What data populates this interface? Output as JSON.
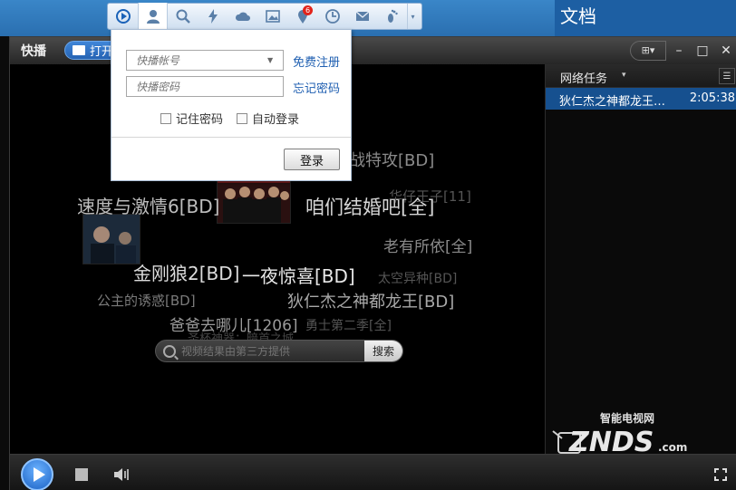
{
  "desktop": {
    "doc_label": "文档"
  },
  "window": {
    "app_title": "快播",
    "open_label": "打开",
    "skin_label": "⊞▾",
    "min_glyph": "–",
    "max_glyph": "□",
    "close_glyph": "✕"
  },
  "user_toolbar": {
    "badge_count": "6",
    "more_glyph": "▾"
  },
  "login": {
    "account_placeholder": "快播帐号",
    "password_placeholder": "快播密码",
    "register_link": "免费注册",
    "forgot_link": "忘记密码",
    "remember_label": "记住密码",
    "autologin_label": "自动登录",
    "login_button": "登录"
  },
  "cloud": [
    {
      "text": "战特攻[BD]",
      "size": 18,
      "color": "#8a8a8a"
    },
    {
      "text": "速度与激情6[BD]",
      "size": 20,
      "color": "#bdbdbd"
    },
    {
      "text": "咱们结婚吧[全]",
      "size": 21,
      "color": "#d6d6d6"
    },
    {
      "text": "华仔王子[11]",
      "size": 15,
      "color": "#555555"
    },
    {
      "text": "老有所依[全]",
      "size": 17,
      "color": "#8a8a8a"
    },
    {
      "text": "金刚狼2[BD]",
      "size": 20,
      "color": "#dcdcdc"
    },
    {
      "text": "一夜惊喜[BD]",
      "size": 20,
      "color": "#e8e8e8"
    },
    {
      "text": "太空异种[BD]",
      "size": 14,
      "color": "#555555"
    },
    {
      "text": "公主的诱惑[BD]",
      "size": 15,
      "color": "#7a7a7a"
    },
    {
      "text": "狄仁杰之神都龙王[BD]",
      "size": 18,
      "color": "#a8a8a8"
    },
    {
      "text": "爸爸去哪儿[1206]",
      "size": 17,
      "color": "#9a9a9a"
    },
    {
      "text": "勇士第二季[全]",
      "size": 14,
      "color": "#555555"
    },
    {
      "text": "圣杯神器：暗首之城",
      "size": 13,
      "color": "#444444"
    }
  ],
  "search": {
    "placeholder": "视频结果由第三方提供",
    "button_label": "搜索"
  },
  "side_panel": {
    "title": "网络任务",
    "arrow": "▾",
    "menu_glyph": "☰",
    "tasks": [
      {
        "name": "狄仁杰之神都龙王…",
        "time": "2:05:38"
      }
    ]
  },
  "watermark": {
    "cn_text": "智能电视网",
    "en_text": "ZNDS",
    "suffix": ".com"
  },
  "colors": {
    "accent_blue": "#16508f",
    "link_blue": "#1f5fb1",
    "badge_red": "#e2231a"
  }
}
